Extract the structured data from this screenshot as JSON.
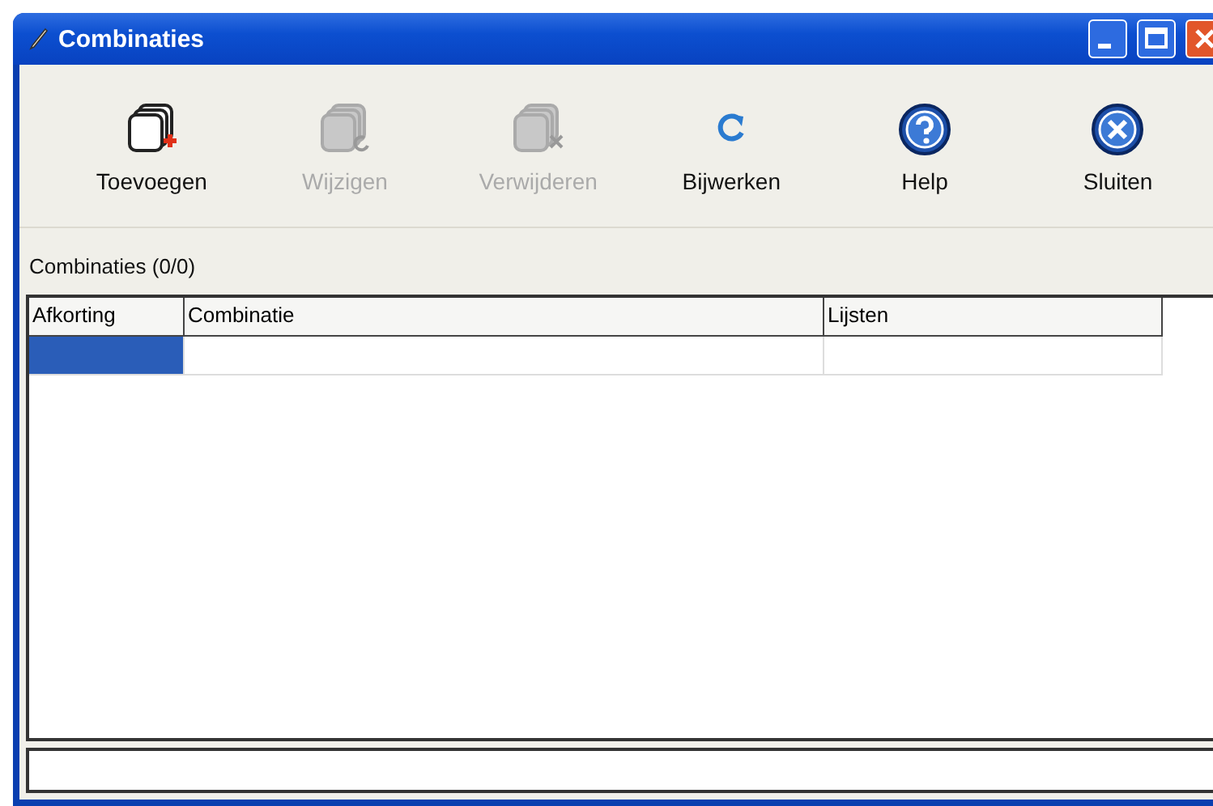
{
  "window": {
    "title": "Combinaties"
  },
  "toolbar": [
    {
      "label": "Toevoegen",
      "kind": "add",
      "disabled": false
    },
    {
      "label": "Wijzigen",
      "kind": "edit",
      "disabled": true
    },
    {
      "label": "Verwijderen",
      "kind": "delete",
      "disabled": true
    },
    {
      "label": "Bijwerken",
      "kind": "refresh",
      "disabled": false
    },
    {
      "label": "Help",
      "kind": "help",
      "disabled": false
    },
    {
      "label": "Sluiten",
      "kind": "close",
      "disabled": false
    }
  ],
  "list_label": "Combinaties (0/0)",
  "table": {
    "columns": [
      "Afkorting",
      "Combinatie",
      "Lijsten"
    ],
    "rows": [
      {
        "selected": true
      }
    ]
  }
}
